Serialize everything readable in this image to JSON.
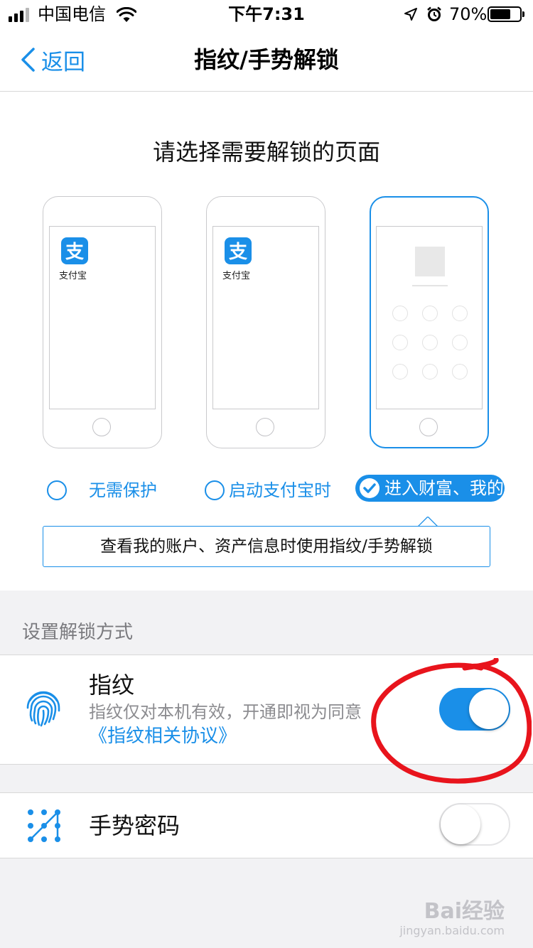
{
  "status_bar": {
    "carrier": "中国电信",
    "time": "下午7:31",
    "battery_percent": "70%",
    "battery_level": 0.7,
    "icons": [
      "signal-icon",
      "wifi-icon",
      "location-icon",
      "alarm-icon",
      "battery-icon"
    ]
  },
  "nav": {
    "back_label": "返回",
    "title": "指纹/手势解锁"
  },
  "selection": {
    "prompt": "请选择需要解锁的页面",
    "phones": [
      {
        "app_label": "支付宝",
        "selected": false
      },
      {
        "app_label": "支付宝",
        "selected": false
      },
      {
        "selected": true,
        "content": "gesture-lock-screen"
      }
    ],
    "options": [
      {
        "label": "无需保护",
        "selected": false
      },
      {
        "label": "启动支付宝时",
        "selected": false
      },
      {
        "label": "进入财富、我的",
        "selected": true
      }
    ],
    "tip": "查看我的账户、资产信息时使用指纹/手势解锁"
  },
  "section_header": "设置解锁方式",
  "fingerprint": {
    "title": "指纹",
    "description": "指纹仅对本机有效，开通即视为同意",
    "link": "《指纹相关协议》",
    "enabled": true
  },
  "gesture": {
    "title": "手势密码",
    "enabled": false
  },
  "watermark": {
    "brand": "Bai经验",
    "url": "jingyan.baidu.com"
  },
  "colors": {
    "accent": "#1a8fe8",
    "annotation": "#e8141c"
  }
}
